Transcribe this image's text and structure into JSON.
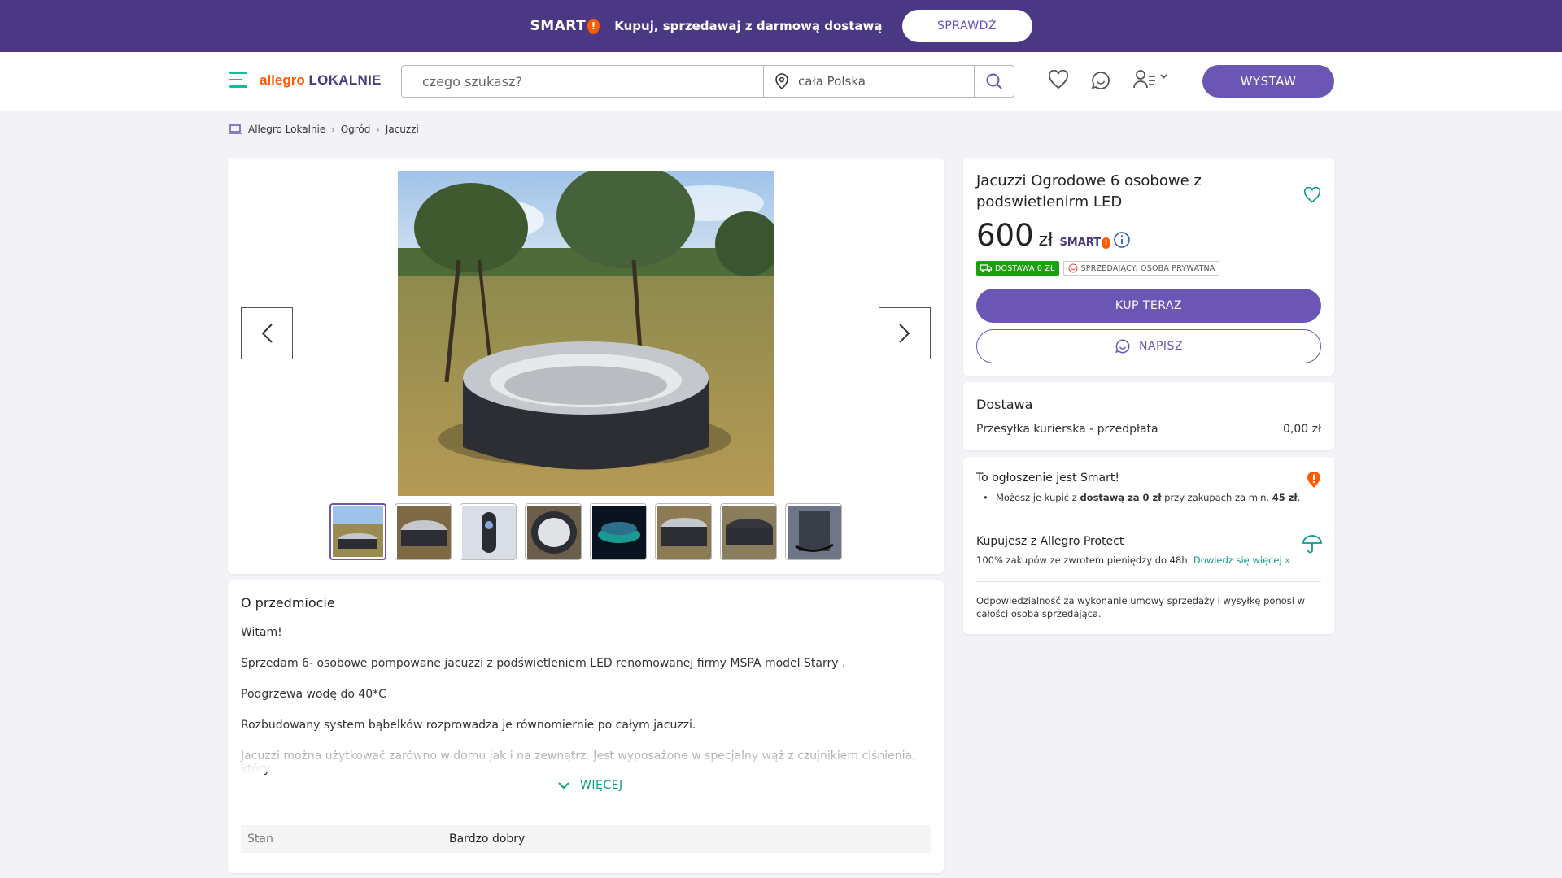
{
  "promo": {
    "logo": "SMART",
    "text": "Kupuj, sprzedawaj z darmową dostawą",
    "button": "SPRAWDŹ"
  },
  "header": {
    "logo_a": "allegro",
    "logo_b": "LOKALNIE",
    "search_placeholder": "czego szukasz?",
    "location": "cała Polska",
    "publish": "WYSTAW"
  },
  "breadcrumb": [
    "Allegro Lokalnie",
    "Ogród",
    "Jacuzzi"
  ],
  "offer": {
    "title": "Jacuzzi Ogrodowe 6 osobowe z podswietlenirm LED",
    "price": "600",
    "currency": "zł",
    "smart": "SMART",
    "badge_delivery": "DOSTAWA 0 ZŁ",
    "badge_seller": "SPRZEDAJĄCY: OSOBA PRYWATNA",
    "buy": "KUP TERAZ",
    "write": "NAPISZ"
  },
  "delivery": {
    "heading": "Dostawa",
    "method": "Przesyłka kurierska - przedpłata",
    "cost": "0,00 zł"
  },
  "smart_box": {
    "title": "To ogłoszenie jest Smart!",
    "text_a": "Możesz je kupić z ",
    "text_b": "dostawą za 0 zł",
    "text_c": " przy zakupach za min. ",
    "text_d": "45 zł",
    "text_e": ".",
    "protect_title": "Kupujesz z Allegro Protect",
    "protect_text": "100% zakupów ze zwrotem pieniędzy do 48h. ",
    "protect_link": "Dowiedz się więcej »",
    "responsibility": "Odpowiedzialność za wykonanie umowy sprzedaży i wysyłkę ponosi w całości osoba sprzedająca."
  },
  "description": {
    "heading": "O przedmiocie",
    "lines": [
      "Witam!",
      "Sprzedam 6- osobowe pompowane jacuzzi z podświetleniem LED renomowanej firmy MSPA model Starry .",
      "Podgrzewa wodę do 40*C",
      "Rozbudowany system bąbelków rozprowadza je równomiernie po całym jacuzzi.",
      "Jacuzzi można użytkować zarówno w domu jak i na zewnątrz. Jest wyposażone w specjalny wąż z czujnikiem ciśnienia, który"
    ],
    "more": "WIĘCEJ",
    "param_key": "Stan",
    "param_value": "Bardzo dobry"
  },
  "colors": {
    "brand_purple": "#6b55b5",
    "promo_bg": "#4b3885",
    "accent_teal": "#0b9c86",
    "allegro_orange": "#ff5a00",
    "delivery_green": "#1da00f"
  }
}
